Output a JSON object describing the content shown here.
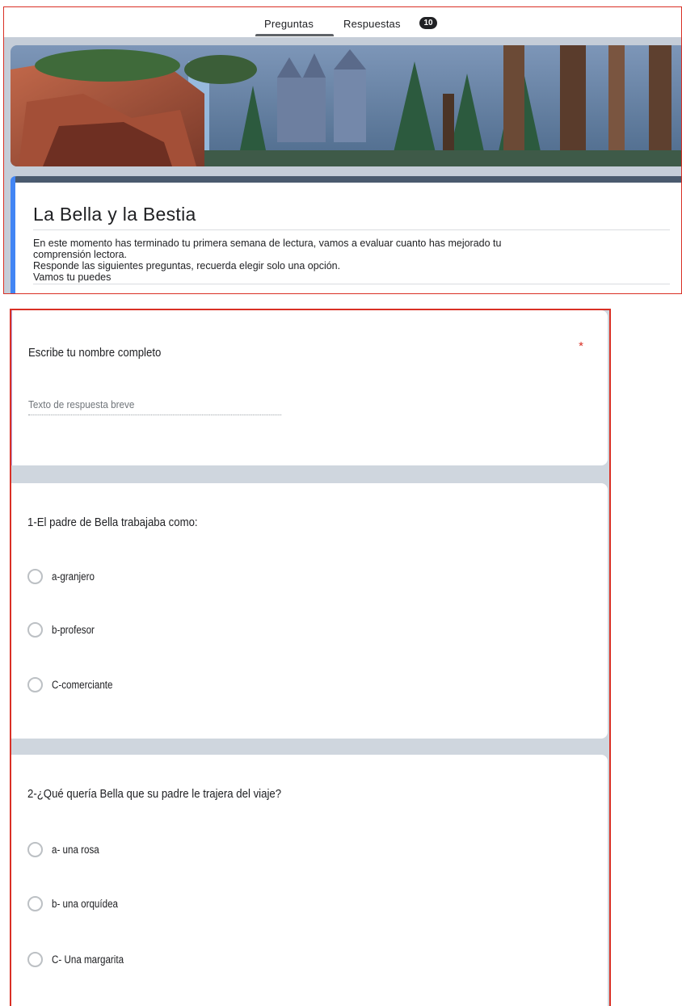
{
  "tabs": {
    "questions_label": "Preguntas",
    "responses_label": "Respuestas",
    "responses_count": "10"
  },
  "form": {
    "title": "La Bella y la Bestia",
    "description": "En este momento has terminado tu primera semana de lectura, vamos a evaluar cuanto has mejorado tu\ncomprensión lectora.\nResponde las siguientes preguntas, recuerda elegir solo una opción.\nVamos tu puedes"
  },
  "questions": [
    {
      "title": "Escribe tu nombre completo",
      "required_mark": "*",
      "placeholder": "Texto de respuesta breve"
    },
    {
      "title": "1-El padre de Bella trabajaba como:",
      "options": [
        "a-granjero",
        "b-profesor",
        "C-comerciante"
      ]
    },
    {
      "title": "2-¿Qué quería Bella que su padre le trajera del viaje?",
      "options": [
        "a- una rosa",
        "b- una orquídea",
        "C- Una margarita"
      ]
    }
  ],
  "colors": {
    "accent_stripe": "#4285f4",
    "header_bar": "#4a5a6e",
    "page_bg": "#c5cdd8",
    "required": "#d93025",
    "outline": "#d93025"
  },
  "icons": {
    "radio": "radio-unchecked-icon"
  }
}
